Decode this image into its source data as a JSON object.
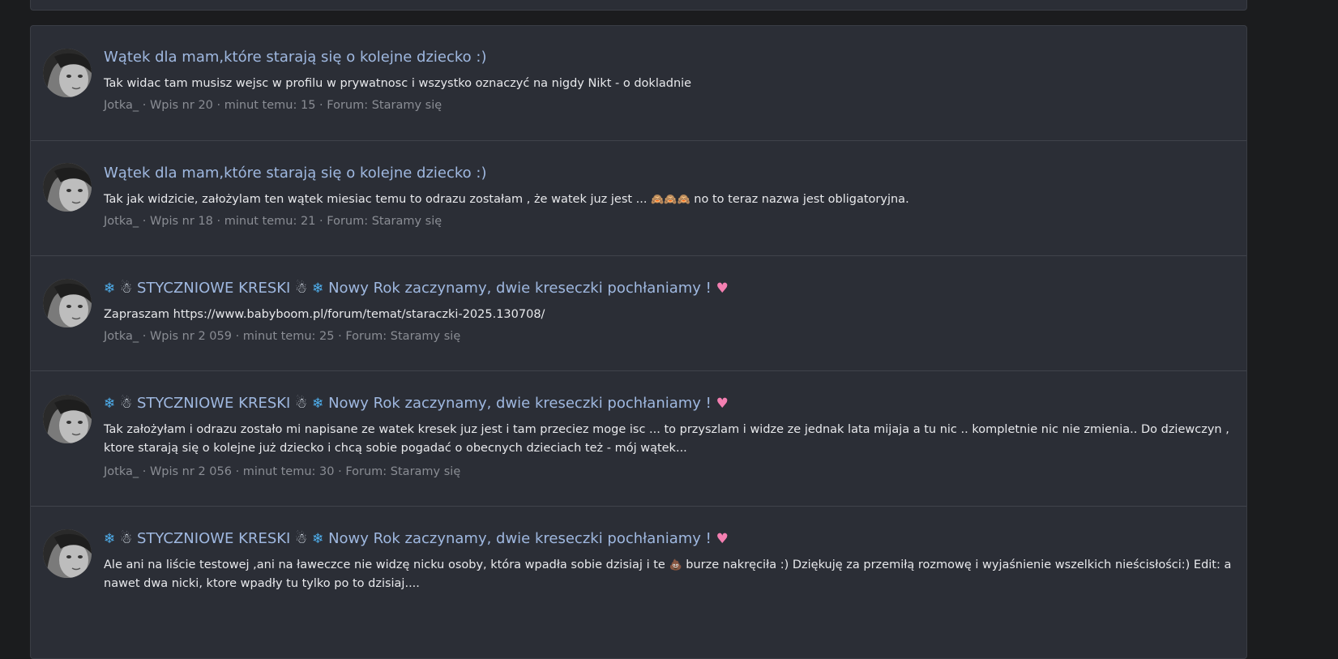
{
  "posts": [
    {
      "title": "Wątek dla mam,które starają się o kolejne dziecko :)",
      "body": "Tak widac tam musisz wejsc w profilu w prywatnosc i wszystko oznaczyć na nigdy Nikt - o dokladnie",
      "author": "Jotka_",
      "entry": "Wpis nr 20",
      "time": "minut temu: 15",
      "forum": "Forum: Staramy się"
    },
    {
      "title": "Wątek dla mam,które starają się o kolejne dziecko :)",
      "body_before": "Tak jak widzicie, założylam ten wątek miesiac temu to odrazu zostałam , że watek juz jest ...",
      "body_emoji": "🙈🙈🙈",
      "body_after": "no to teraz nazwa jest obligatoryjna.",
      "author": "Jotka_",
      "entry": "Wpis nr 18",
      "time": "minut temu: 21",
      "forum": "Forum: Staramy się"
    },
    {
      "title_snow": "❄",
      "title_snowman": "☃",
      "title_main": "STYCZNIOWE KRESKI",
      "title_tail": "Nowy Rok zaczynamy, dwie kreseczki pochłaniamy !",
      "title_heart": "♥",
      "body": "Zapraszam https://www.babyboom.pl/forum/temat/staraczki-2025.130708/",
      "author": "Jotka_",
      "entry": "Wpis nr 2 059",
      "time": "minut temu: 25",
      "forum": "Forum: Staramy się"
    },
    {
      "title_snow": "❄",
      "title_snowman": "☃",
      "title_main": "STYCZNIOWE KRESKI",
      "title_tail": "Nowy Rok zaczynamy, dwie kreseczki pochłaniamy !",
      "title_heart": "♥",
      "body": "Tak założyłam i odrazu zostało mi napisane ze watek kresek juz jest i tam przeciez moge isc ... to przyszlam i widze ze jednak lata mijaja a tu nic .. kompletnie nic nie zmienia.. Do dziewczyn , ktore starają się o kolejne już dziecko i chcą sobie pogadać o obecnych dzieciach też - mój wątek...",
      "author": "Jotka_",
      "entry": "Wpis nr 2 056",
      "time": "minut temu: 30",
      "forum": "Forum: Staramy się"
    },
    {
      "title_snow": "❄",
      "title_snowman": "☃",
      "title_main": "STYCZNIOWE KRESKI",
      "title_tail": "Nowy Rok zaczynamy, dwie kreseczki pochłaniamy !",
      "title_heart": "♥",
      "body_before": "Ale ani na liście testowej ,ani na ławeczce nie widzę nicku osoby, która wpadła sobie dzisiaj i te",
      "body_emoji": "💩",
      "body_after": "burze nakręciła :) Dziękuję za przemiłą rozmowę i wyjaśnienie wszelkich nieścisłości:) Edit: a nawet dwa nicki, ktore wpadły tu tylko po to dzisiaj...."
    }
  ],
  "meta_separator": " · ",
  "colors": {
    "background": "#1b1c1e",
    "panel": "#2b2e36",
    "title_link": "#9fb8e0",
    "body_text": "#e8e9ec",
    "meta_text": "#8a8d94",
    "snowflake": "#4fb0ef",
    "heart": "#f47fb1"
  }
}
